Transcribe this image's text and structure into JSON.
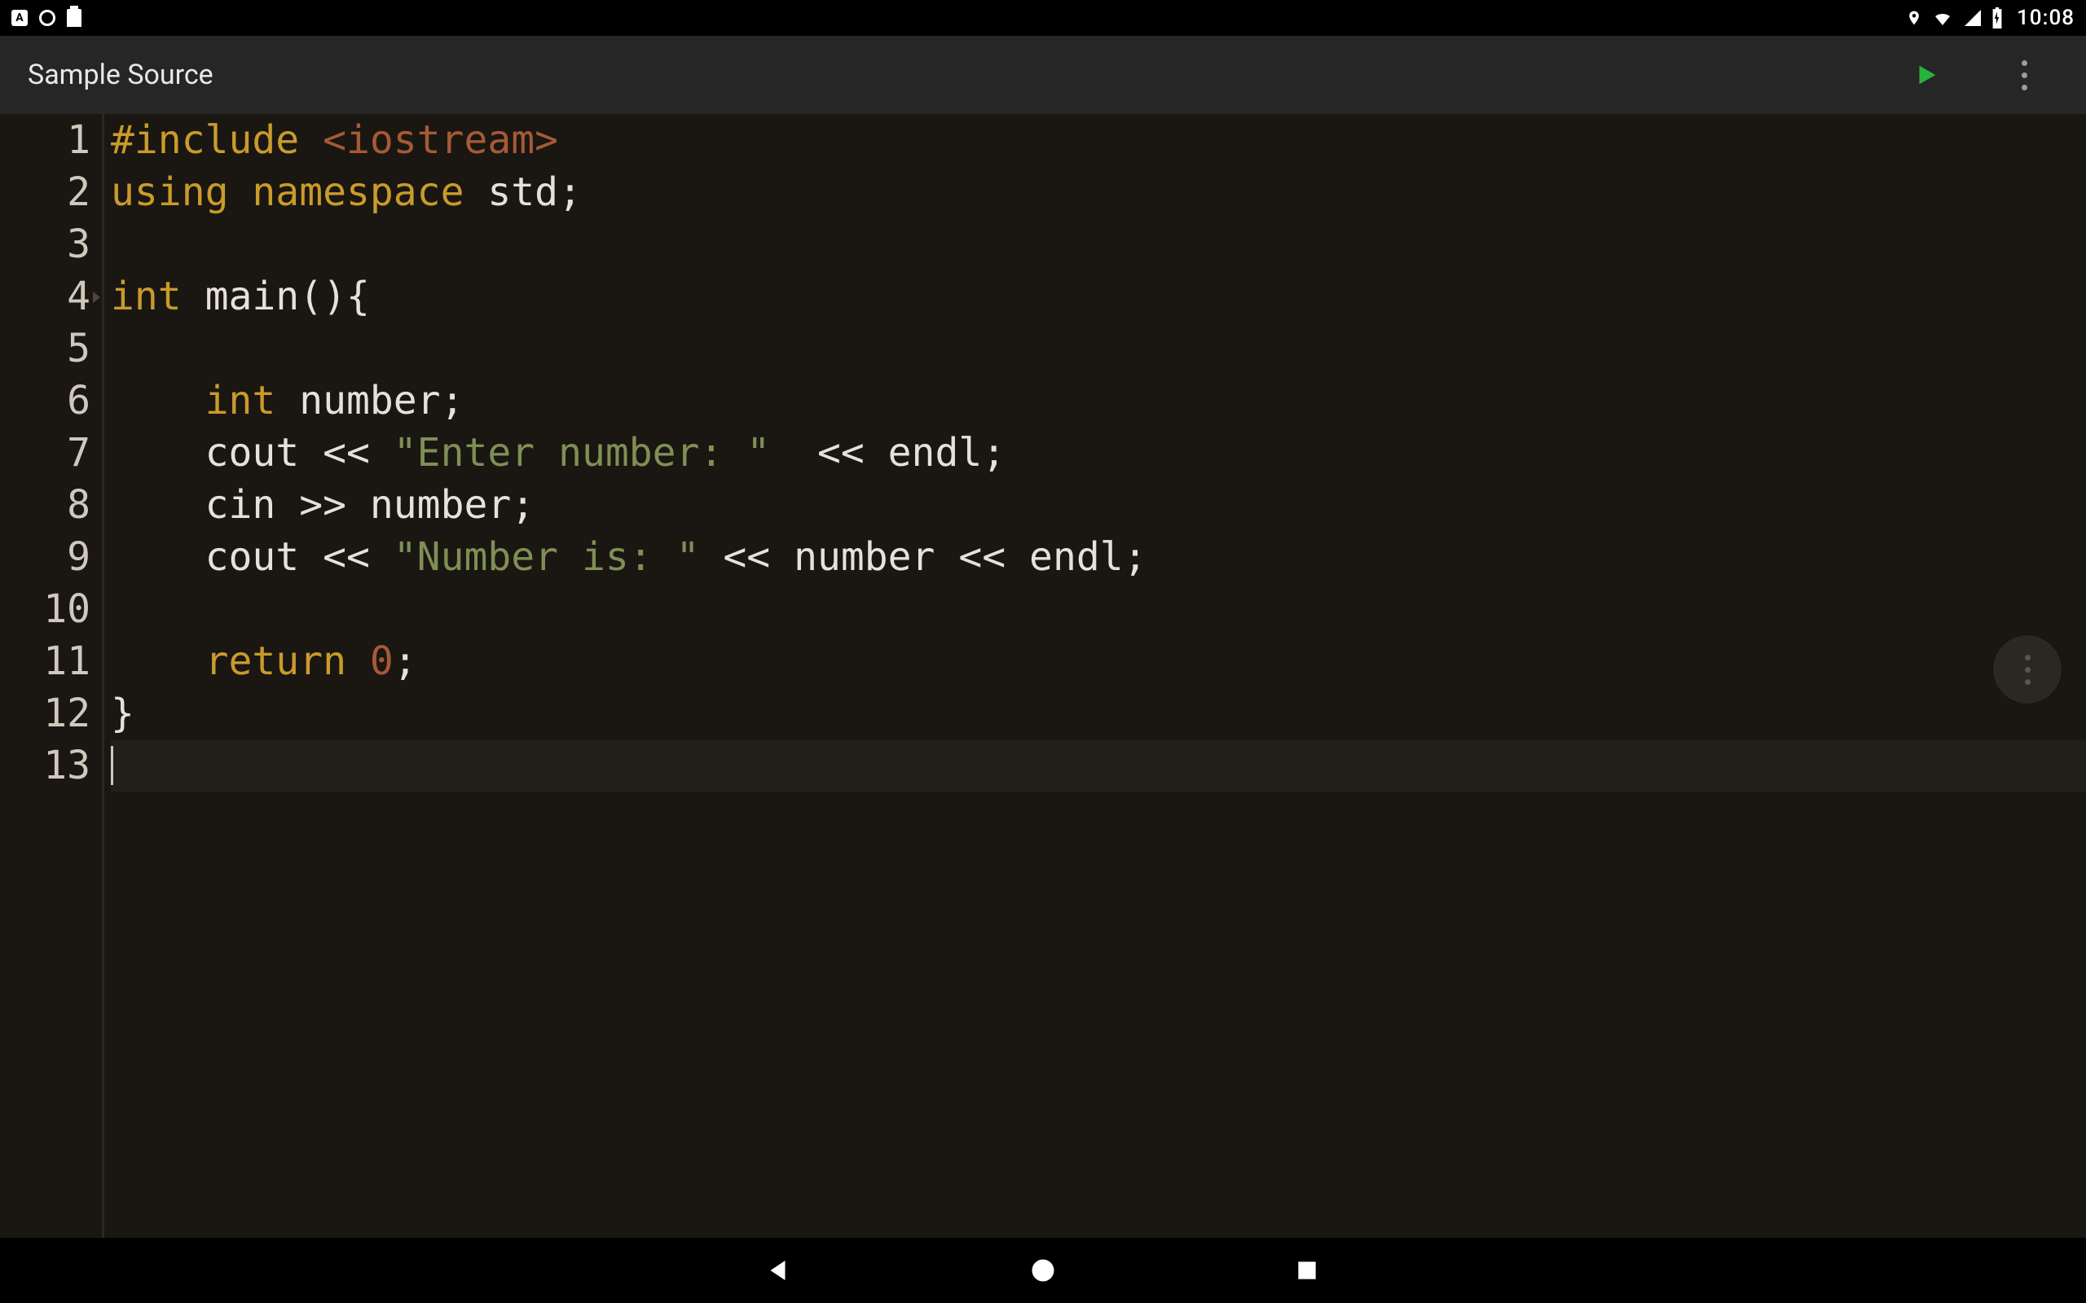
{
  "status_bar": {
    "clock": "10:08",
    "icons_left": [
      "keyboard-icon",
      "circle-icon",
      "sdcard-icon"
    ],
    "icons_right": [
      "location-icon",
      "wifi-icon",
      "signal-icon",
      "battery-charging-icon"
    ]
  },
  "action_bar": {
    "title": "Sample Source"
  },
  "editor": {
    "current_line": 13,
    "lines": [
      {
        "n": 1,
        "fold": false,
        "tokens": [
          [
            "pre",
            "#include "
          ],
          [
            "inc",
            "<iostream>"
          ]
        ]
      },
      {
        "n": 2,
        "fold": false,
        "tokens": [
          [
            "kw",
            "using "
          ],
          [
            "kw",
            "namespace "
          ],
          [
            "def",
            "std"
          ],
          [
            "punc",
            ";"
          ]
        ]
      },
      {
        "n": 3,
        "fold": false,
        "tokens": []
      },
      {
        "n": 4,
        "fold": true,
        "tokens": [
          [
            "kw",
            "int "
          ],
          [
            "def",
            "main(){"
          ]
        ]
      },
      {
        "n": 5,
        "fold": false,
        "tokens": []
      },
      {
        "n": 6,
        "fold": false,
        "tokens": [
          [
            "def",
            "    "
          ],
          [
            "kw",
            "int "
          ],
          [
            "def",
            "number"
          ],
          [
            "punc",
            ";"
          ]
        ]
      },
      {
        "n": 7,
        "fold": false,
        "tokens": [
          [
            "def",
            "    cout << "
          ],
          [
            "str",
            "\"Enter number: \""
          ],
          [
            "def",
            "  << endl"
          ],
          [
            "punc",
            ";"
          ]
        ]
      },
      {
        "n": 8,
        "fold": false,
        "tokens": [
          [
            "def",
            "    cin >> number"
          ],
          [
            "punc",
            ";"
          ]
        ]
      },
      {
        "n": 9,
        "fold": false,
        "tokens": [
          [
            "def",
            "    cout << "
          ],
          [
            "str",
            "\"Number is: \""
          ],
          [
            "def",
            " << number << endl"
          ],
          [
            "punc",
            ";"
          ]
        ]
      },
      {
        "n": 10,
        "fold": false,
        "tokens": []
      },
      {
        "n": 11,
        "fold": false,
        "tokens": [
          [
            "def",
            "    "
          ],
          [
            "kw",
            "return "
          ],
          [
            "num",
            "0"
          ],
          [
            "punc",
            ";"
          ]
        ]
      },
      {
        "n": 12,
        "fold": false,
        "tokens": [
          [
            "def",
            "}"
          ]
        ]
      },
      {
        "n": 13,
        "fold": false,
        "tokens": []
      }
    ]
  }
}
